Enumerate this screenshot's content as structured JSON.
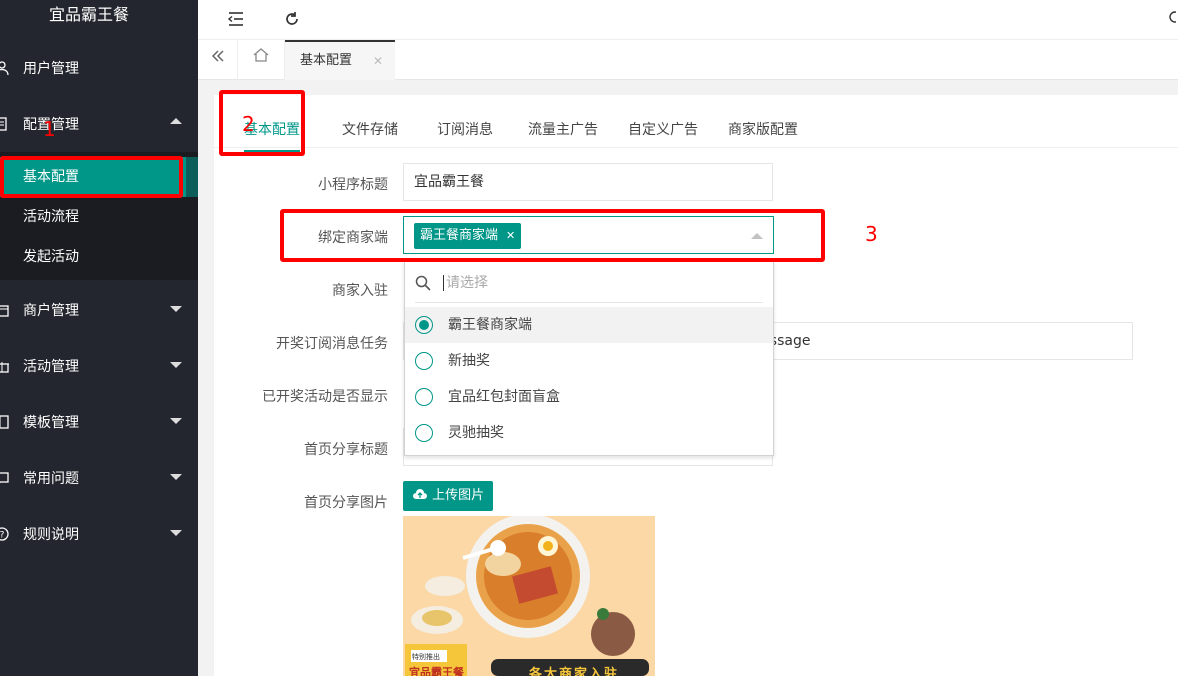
{
  "app": {
    "title": "宜品霸王餐"
  },
  "sidebar": {
    "items": [
      {
        "label": "用户管理",
        "icon": "user-icon"
      },
      {
        "label": "配置管理",
        "icon": "settings-icon",
        "expanded": true
      },
      {
        "label": "商户管理",
        "icon": "shop-icon"
      },
      {
        "label": "活动管理",
        "icon": "gift-icon"
      },
      {
        "label": "模板管理",
        "icon": "template-icon"
      },
      {
        "label": "常用问题",
        "icon": "question-icon"
      },
      {
        "label": "规则说明",
        "icon": "info-icon"
      }
    ],
    "subitems": [
      {
        "label": "基本配置",
        "active": true
      },
      {
        "label": "活动流程"
      },
      {
        "label": "发起活动"
      }
    ]
  },
  "tabbar": {
    "active_tab": "基本配置"
  },
  "content_tabs": [
    "基本配置",
    "文件存储",
    "订阅消息",
    "流量主广告",
    "自定义广告",
    "商家版配置"
  ],
  "form": {
    "mini_title_label": "小程序标题",
    "mini_title_value": "宜品霸王餐",
    "bind_label": "绑定商家端",
    "bind_chip": "霸王餐商家端",
    "merchant_entry_label": "商家入驻",
    "lottery_task_label": "开奖订阅消息任务",
    "lottery_task_value": "n=lingchi_bwc&a=wxapp&do=index&action=kjMessage",
    "show_finished_label": "已开奖活动是否显示",
    "share_title_label": "首页分享标题",
    "share_image_label": "首页分享图片",
    "upload_label": "上传图片"
  },
  "dropdown": {
    "placeholder": "请选择",
    "options": [
      {
        "label": "霸王餐商家端",
        "selected": true
      },
      {
        "label": "新抽奖"
      },
      {
        "label": "宜品红包封面盲盒"
      },
      {
        "label": "灵驰抽奖"
      }
    ]
  },
  "preview": {
    "badge": "特别推出",
    "brand": "宜品霸王餐",
    "slogan": "各大商家入驻"
  },
  "annotations": [
    "1",
    "2",
    "3"
  ],
  "colors": {
    "accent": "#009688",
    "sidebar": "#23262e",
    "annotation": "#ff0000"
  }
}
